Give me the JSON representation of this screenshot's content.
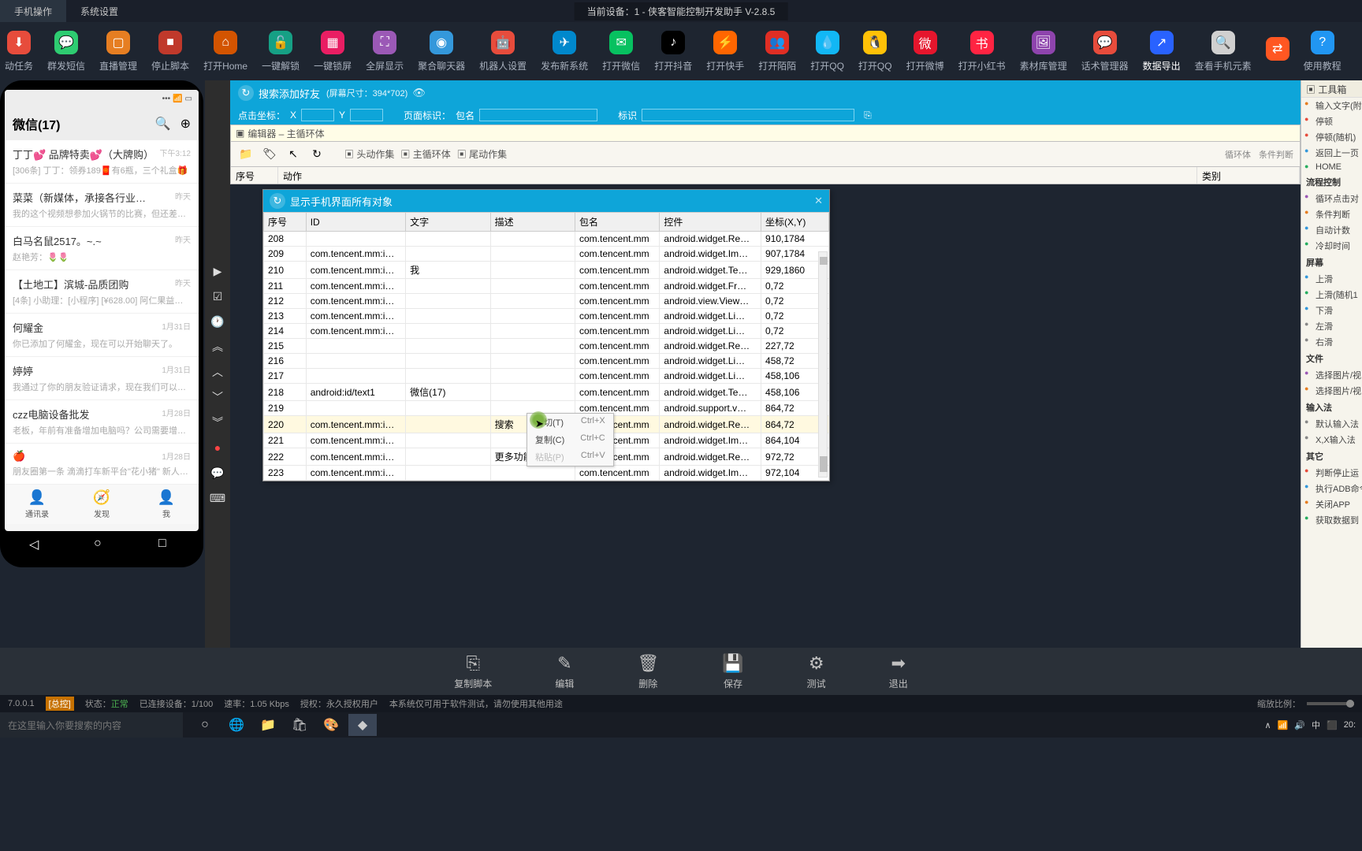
{
  "menubar": {
    "items": [
      "手机操作",
      "系统设置"
    ]
  },
  "deviceTitle": "当前设备：1 - 侠客智能控制开发助手 V-2.8.5",
  "toolbar": [
    {
      "label": "动任务",
      "cls": "i-red",
      "glyph": "⬇"
    },
    {
      "label": "群发短信",
      "cls": "i-green",
      "glyph": "💬"
    },
    {
      "label": "直播管理",
      "cls": "i-orange",
      "glyph": "▢"
    },
    {
      "label": "停止脚本",
      "cls": "i-darkred",
      "glyph": "■"
    },
    {
      "label": "打开Home",
      "cls": "i-house",
      "glyph": "⌂"
    },
    {
      "label": "一键解锁",
      "cls": "i-lock",
      "glyph": "🔓"
    },
    {
      "label": "一键锁屏",
      "cls": "i-grid",
      "glyph": "▦"
    },
    {
      "label": "全屏显示",
      "cls": "i-purple",
      "glyph": "⛶"
    },
    {
      "label": "聚合聊天器",
      "cls": "i-blue",
      "glyph": "◉"
    },
    {
      "label": "机器人设置",
      "cls": "i-robot",
      "glyph": "🤖"
    },
    {
      "label": "发布新系统",
      "cls": "i-tg",
      "glyph": "✈"
    },
    {
      "label": "打开微信",
      "cls": "i-wechat",
      "glyph": "✉"
    },
    {
      "label": "打开抖音",
      "cls": "i-dy",
      "glyph": "♪"
    },
    {
      "label": "打开快手",
      "cls": "i-ks",
      "glyph": "⚡"
    },
    {
      "label": "打开陌陌",
      "cls": "i-pdd",
      "glyph": "👥"
    },
    {
      "label": "打开QQ",
      "cls": "i-qq",
      "glyph": "💧"
    },
    {
      "label": "打开QQ",
      "cls": "i-qqp",
      "glyph": "🐧"
    },
    {
      "label": "打开微博",
      "cls": "i-weibo",
      "glyph": "微"
    },
    {
      "label": "打开小红书",
      "cls": "i-xhs",
      "glyph": "书"
    },
    {
      "label": "素材库管理",
      "cls": "i-lib",
      "glyph": "🖼"
    },
    {
      "label": "话术管理器",
      "cls": "i-chat",
      "glyph": "💬"
    },
    {
      "label": "数据导出",
      "cls": "i-export",
      "glyph": "↗",
      "active": true
    },
    {
      "label": "查看手机元素",
      "cls": "i-serial",
      "glyph": "🔍"
    },
    {
      "label": "",
      "cls": "i-share",
      "glyph": "⇄"
    },
    {
      "label": "使用教程",
      "cls": "i-help",
      "glyph": "?"
    }
  ],
  "phone": {
    "headerTitle": "微信(17)",
    "chats": [
      {
        "name": "丁丁💕 品牌特卖💕（大牌购）",
        "time": "下午3:12",
        "sub": "[306条] 丁丁：领券189🧧有6瓶，三个礼盒🎁"
      },
      {
        "name": "菜菜（新媒体，承接各行业广告…",
        "time": "昨天",
        "sub": "我的这个视频想参加火锅节的比赛，但还差20…"
      },
      {
        "name": "白马名鼠2517。~.~",
        "time": "昨天",
        "sub": "赵艳芳：🌷🌷"
      },
      {
        "name": "【土地工】滨城-品质团购",
        "time": "昨天",
        "sub": "[4条] 小助理：[小程序] [¥628.00] 阿仁果益莱…"
      },
      {
        "name": "何耀金",
        "time": "1月31日",
        "sub": "你已添加了何耀金，现在可以开始聊天了。"
      },
      {
        "name": "婷婷",
        "time": "1月31日",
        "sub": "我通过了你的朋友验证请求，现在我们可以开…"
      },
      {
        "name": "czz电脑设备批发",
        "time": "1月28日",
        "sub": "老板，年前有准备增加电脑吗？公司需要增加…"
      },
      {
        "name": "🍎",
        "time": "1月28日",
        "sub": "朋友圈第一条 滴滴打车新平台\"花小猪\" 新人…"
      }
    ],
    "tabs": [
      "通讯录",
      "发现",
      "我"
    ]
  },
  "panel": {
    "title": "搜索添加好友",
    "screenSize": "(屏幕尺寸：394*702)",
    "coordLabel": "点击坐标：",
    "x": "X",
    "y": "Y",
    "pageIdLabel": "页面标识：",
    "pageIdHint": "包名",
    "markLabel": "标识"
  },
  "editor": {
    "title": "编辑器 – 主循环体",
    "groups": [
      "头动作集",
      "主循环体",
      "尾动作集"
    ],
    "right": [
      "循环体",
      "条件判断"
    ],
    "cols": {
      "seq": "序号",
      "action": "动作",
      "type": "类别"
    }
  },
  "modal": {
    "title": "显示手机界面所有对象",
    "headers": [
      "序号",
      "ID",
      "文字",
      "描述",
      "包名",
      "控件",
      "坐标(X,Y)"
    ],
    "rows": [
      {
        "seq": "208",
        "id": "",
        "txt": "",
        "desc": "",
        "pkg": "com.tencent.mm",
        "ctrl": "android.widget.Re…",
        "coord": "910,1784"
      },
      {
        "seq": "209",
        "id": "com.tencent.mm:i…",
        "txt": "",
        "desc": "",
        "pkg": "com.tencent.mm",
        "ctrl": "android.widget.Im…",
        "coord": "907,1784"
      },
      {
        "seq": "210",
        "id": "com.tencent.mm:i…",
        "txt": "我",
        "desc": "",
        "pkg": "com.tencent.mm",
        "ctrl": "android.widget.Te…",
        "coord": "929,1860"
      },
      {
        "seq": "211",
        "id": "com.tencent.mm:i…",
        "txt": "",
        "desc": "",
        "pkg": "com.tencent.mm",
        "ctrl": "android.widget.Fr…",
        "coord": "0,72"
      },
      {
        "seq": "212",
        "id": "com.tencent.mm:i…",
        "txt": "",
        "desc": "",
        "pkg": "com.tencent.mm",
        "ctrl": "android.view.View…",
        "coord": "0,72"
      },
      {
        "seq": "213",
        "id": "com.tencent.mm:i…",
        "txt": "",
        "desc": "",
        "pkg": "com.tencent.mm",
        "ctrl": "android.widget.Li…",
        "coord": "0,72"
      },
      {
        "seq": "214",
        "id": "com.tencent.mm:i…",
        "txt": "",
        "desc": "",
        "pkg": "com.tencent.mm",
        "ctrl": "android.widget.Li…",
        "coord": "0,72"
      },
      {
        "seq": "215",
        "id": "",
        "txt": "",
        "desc": "",
        "pkg": "com.tencent.mm",
        "ctrl": "android.widget.Re…",
        "coord": "227,72"
      },
      {
        "seq": "216",
        "id": "",
        "txt": "",
        "desc": "",
        "pkg": "com.tencent.mm",
        "ctrl": "android.widget.Li…",
        "coord": "458,72"
      },
      {
        "seq": "217",
        "id": "",
        "txt": "",
        "desc": "",
        "pkg": "com.tencent.mm",
        "ctrl": "android.widget.Li…",
        "coord": "458,106"
      },
      {
        "seq": "218",
        "id": "android:id/text1",
        "txt": "微信(17)",
        "desc": "",
        "pkg": "com.tencent.mm",
        "ctrl": "android.widget.Te…",
        "coord": "458,106"
      },
      {
        "seq": "219",
        "id": "",
        "txt": "",
        "desc": "",
        "pkg": "com.tencent.mm",
        "ctrl": "android.support.v…",
        "coord": "864,72"
      },
      {
        "seq": "220",
        "id": "com.tencent.mm:i…",
        "txt": "",
        "desc": "搜索",
        "pkg": "com.tencent.mm",
        "ctrl": "android.widget.Re…",
        "coord": "864,72",
        "hl": true
      },
      {
        "seq": "221",
        "id": "com.tencent.mm:i…",
        "txt": "",
        "desc": "",
        "pkg": "com.tencent.mm",
        "ctrl": "android.widget.Im…",
        "coord": "864,104"
      },
      {
        "seq": "222",
        "id": "com.tencent.mm:i…",
        "txt": "",
        "desc": "更多功能按钮",
        "pkg": "com.tencent.mm",
        "ctrl": "android.widget.Re…",
        "coord": "972,72"
      },
      {
        "seq": "223",
        "id": "com.tencent.mm:i…",
        "txt": "",
        "desc": "",
        "pkg": "com.tencent.mm",
        "ctrl": "android.widget.Im…",
        "coord": "972,104"
      }
    ]
  },
  "contextMenu": [
    {
      "label": "剪切(T)",
      "key": "Ctrl+X"
    },
    {
      "label": "复制(C)",
      "key": "Ctrl+C"
    },
    {
      "label": "粘贴(P)",
      "key": "Ctrl+V",
      "disabled": true
    }
  ],
  "toolbox": {
    "title": "工具箱",
    "groups": [
      {
        "items": [
          {
            "label": "输入文字(附",
            "cls": "tb-orange"
          },
          {
            "label": "停顿",
            "cls": "tb-red"
          },
          {
            "label": "停顿(随机)",
            "cls": "tb-red"
          },
          {
            "label": "返回上一页",
            "cls": "tb-blue"
          },
          {
            "label": "HOME",
            "cls": "tb-green"
          }
        ]
      },
      {
        "name": "流程控制",
        "items": [
          {
            "label": "循环点击对",
            "cls": "tb-purple"
          },
          {
            "label": "条件判断",
            "cls": "tb-orange"
          },
          {
            "label": "自动计数",
            "cls": "tb-blue"
          },
          {
            "label": "冷却时间",
            "cls": "tb-green"
          }
        ]
      },
      {
        "name": "屏幕",
        "items": [
          {
            "label": "上滑",
            "cls": "tb-blue"
          },
          {
            "label": "上滑(随机1",
            "cls": "tb-green"
          },
          {
            "label": "下滑",
            "cls": "tb-blue"
          },
          {
            "label": "左滑",
            "cls": "tb-gray"
          },
          {
            "label": "右滑",
            "cls": "tb-gray"
          }
        ]
      },
      {
        "name": "文件",
        "items": [
          {
            "label": "选择图片/视",
            "cls": "tb-purple"
          },
          {
            "label": "选择图片/视",
            "cls": "tb-orange"
          }
        ]
      },
      {
        "name": "输入法",
        "items": [
          {
            "label": "默认输入法",
            "cls": "tb-gray"
          },
          {
            "label": "X,X输入法",
            "cls": "tb-gray"
          }
        ]
      },
      {
        "name": "其它",
        "items": [
          {
            "label": "判断停止运",
            "cls": "tb-red"
          },
          {
            "label": "执行ADB命令",
            "cls": "tb-blue"
          },
          {
            "label": "关闭APP",
            "cls": "tb-orange"
          },
          {
            "label": "获取数据到",
            "cls": "tb-green"
          }
        ]
      }
    ]
  },
  "actions": [
    {
      "label": "复制脚本",
      "icon": "⎘"
    },
    {
      "label": "编辑",
      "icon": "✎"
    },
    {
      "label": "删除",
      "icon": "🗑"
    },
    {
      "label": "保存",
      "icon": "💾"
    },
    {
      "label": "测试",
      "icon": "⚙"
    },
    {
      "label": "退出",
      "icon": "➡"
    }
  ],
  "statusbar": {
    "ip": "7.0.0.1",
    "tag": "[总控]",
    "status": "状态：",
    "statusVal": "正常",
    "conn": "已连接设备：",
    "connVal": "1/100",
    "speed": "速率：",
    "speedVal": "1.05 Kbps",
    "auth": "授权：永久授权用户",
    "note": "本系统仅可用于软件测试，请勿使用其他用途",
    "zoom": "缩放比例："
  },
  "taskbar": {
    "search": "在这里输入你要搜索的内容",
    "tray": [
      "∧",
      "📶",
      "🔊",
      "中",
      "⬛"
    ],
    "clock": "20:"
  }
}
